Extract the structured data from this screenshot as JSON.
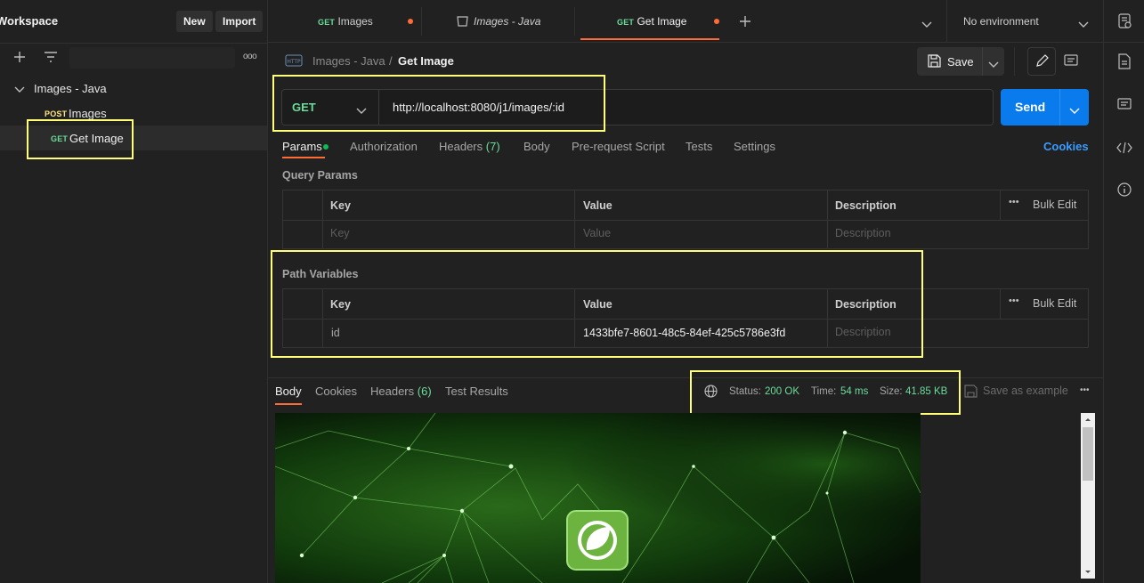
{
  "sidebar": {
    "workspace_title": "Workspace",
    "new_label": "New",
    "import_label": "Import",
    "more_label": "ooo",
    "collection": {
      "name": "Images - Java",
      "items": [
        {
          "method": "POST",
          "name": "Images"
        },
        {
          "method": "GET",
          "name": "Get Image"
        }
      ]
    }
  },
  "tabs": [
    {
      "method": "GET",
      "name": "Images",
      "unsaved": true
    },
    {
      "method": "",
      "name": "Images - Java",
      "unsaved": false
    },
    {
      "method": "GET",
      "name": "Get Image",
      "unsaved": true
    }
  ],
  "environment": {
    "label": "No environment"
  },
  "request": {
    "breadcrumb_collection": "Images - Java",
    "breadcrumb_separator": "/",
    "breadcrumb_request": "Get Image",
    "protocol_badge": "HTTP",
    "save_label": "Save",
    "method": "GET",
    "url": "http://localhost:8080/j1/images/:id",
    "send_label": "Send",
    "tabs": [
      {
        "label": "Params",
        "badge": "",
        "active": true
      },
      {
        "label": "Authorization",
        "badge": ""
      },
      {
        "label": "Headers",
        "badge": "(7)"
      },
      {
        "label": "Body",
        "badge": ""
      },
      {
        "label": "Pre-request Script",
        "badge": ""
      },
      {
        "label": "Tests",
        "badge": ""
      },
      {
        "label": "Settings",
        "badge": ""
      }
    ],
    "cookies_label": "Cookies",
    "query_params": {
      "title": "Query Params",
      "headers": {
        "key": "Key",
        "value": "Value",
        "description": "Description",
        "bulk": "Bulk Edit"
      },
      "placeholder": {
        "key": "Key",
        "value": "Value",
        "description": "Description"
      }
    },
    "path_variables": {
      "title": "Path Variables",
      "headers": {
        "key": "Key",
        "value": "Value",
        "description": "Description",
        "bulk": "Bulk Edit"
      },
      "row": {
        "key": "id",
        "value": "1433bfe7-8601-48c5-84ef-425c5786e3fd",
        "description": "Description"
      }
    }
  },
  "response": {
    "tabs": [
      {
        "label": "Body",
        "active": true
      },
      {
        "label": "Cookies"
      },
      {
        "label": "Headers",
        "badge": "(6)"
      },
      {
        "label": "Test Results"
      }
    ],
    "status_label": "Status:",
    "status_value": "200 OK",
    "time_label": "Time:",
    "time_value": "54 ms",
    "size_label": "Size:",
    "size_value": "41.85 KB",
    "save_example_label": "Save as example"
  },
  "colors": {
    "accent_orange": "#ff6c37",
    "send_blue": "#097bed",
    "get_green": "#6bdd9a",
    "post_yellow": "#ffe47e",
    "highlight_yellow": "#fffe7a"
  }
}
